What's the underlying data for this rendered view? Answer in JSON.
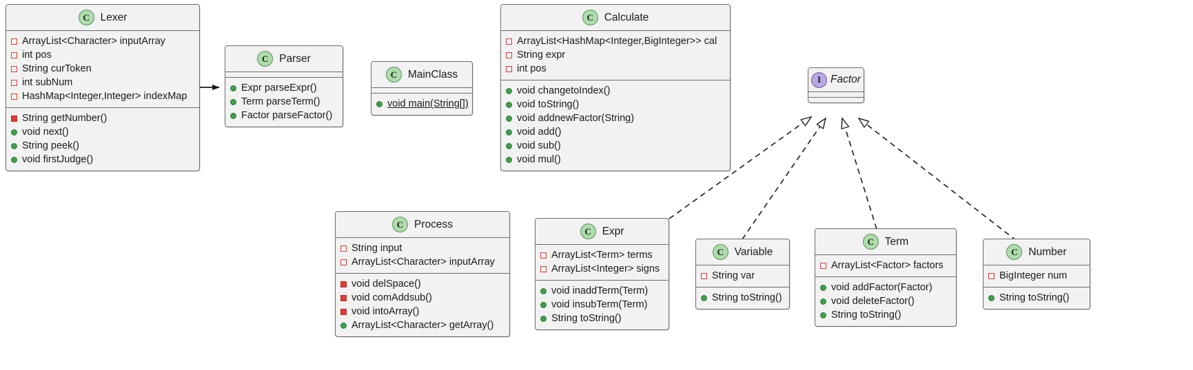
{
  "diagram": {
    "kind": "uml-class-diagram",
    "background": "#ffffff",
    "colors": {
      "class_icon_fill": "#adddab",
      "interface_icon_fill": "#b9a8e0",
      "private_field_marker": "#d33d3d",
      "public_method_marker": "#3f9e4d",
      "private_method_marker": "#e23b35",
      "node_fill": "#f2f2f2",
      "node_border": "#6b6b6b"
    }
  },
  "nodes": [
    {
      "id": "lexer",
      "name": "Lexer",
      "stereotype": "C",
      "fields": [
        {
          "visibility": "private",
          "text": "ArrayList<Character> inputArray"
        },
        {
          "visibility": "private",
          "text": "int pos"
        },
        {
          "visibility": "private",
          "text": "String curToken"
        },
        {
          "visibility": "private",
          "text": "int subNum"
        },
        {
          "visibility": "private",
          "text": "HashMap<Integer,Integer> indexMap"
        }
      ],
      "methods": [
        {
          "visibility": "private",
          "text": "String getNumber()"
        },
        {
          "visibility": "public",
          "text": "void next()"
        },
        {
          "visibility": "public",
          "text": "String peek()"
        },
        {
          "visibility": "public",
          "text": "void firstJudge()"
        }
      ]
    },
    {
      "id": "parser",
      "name": "Parser",
      "stereotype": "C",
      "fields": [],
      "methods": [
        {
          "visibility": "public",
          "text": "Expr parseExpr()"
        },
        {
          "visibility": "public",
          "text": "Term parseTerm()"
        },
        {
          "visibility": "public",
          "text": "Factor parseFactor()"
        }
      ]
    },
    {
      "id": "mainclass",
      "name": "MainClass",
      "stereotype": "C",
      "fields": [],
      "methods": [
        {
          "visibility": "public",
          "text": "void main(String[])",
          "static": true
        }
      ]
    },
    {
      "id": "calculate",
      "name": "Calculate",
      "stereotype": "C",
      "fields": [
        {
          "visibility": "private",
          "text": "ArrayList<HashMap<Integer,BigInteger>> cal"
        },
        {
          "visibility": "private",
          "text": "String expr"
        },
        {
          "visibility": "private",
          "text": "int pos"
        }
      ],
      "methods": [
        {
          "visibility": "public",
          "text": "void changetoIndex()"
        },
        {
          "visibility": "public",
          "text": "void toString()"
        },
        {
          "visibility": "public",
          "text": "void addnewFactor(String)"
        },
        {
          "visibility": "public",
          "text": "void add()"
        },
        {
          "visibility": "public",
          "text": "void sub()"
        },
        {
          "visibility": "public",
          "text": "void mul()"
        }
      ]
    },
    {
      "id": "factor",
      "name": "Factor",
      "stereotype": "I",
      "fields": [],
      "methods": []
    },
    {
      "id": "process",
      "name": "Process",
      "stereotype": "C",
      "fields": [
        {
          "visibility": "private",
          "text": "String input"
        },
        {
          "visibility": "private",
          "text": "ArrayList<Character> inputArray"
        }
      ],
      "methods": [
        {
          "visibility": "private",
          "text": "void delSpace()"
        },
        {
          "visibility": "private",
          "text": "void comAddsub()"
        },
        {
          "visibility": "private",
          "text": "void intoArray()"
        },
        {
          "visibility": "public",
          "text": "ArrayList<Character> getArray()"
        }
      ]
    },
    {
      "id": "expr",
      "name": "Expr",
      "stereotype": "C",
      "fields": [
        {
          "visibility": "private",
          "text": "ArrayList<Term> terms"
        },
        {
          "visibility": "private",
          "text": "ArrayList<Integer> signs"
        }
      ],
      "methods": [
        {
          "visibility": "public",
          "text": "void inaddTerm(Term)"
        },
        {
          "visibility": "public",
          "text": "void insubTerm(Term)"
        },
        {
          "visibility": "public",
          "text": "String toString()"
        }
      ]
    },
    {
      "id": "variable",
      "name": "Variable",
      "stereotype": "C",
      "fields": [
        {
          "visibility": "private",
          "text": "String var"
        }
      ],
      "methods": [
        {
          "visibility": "public",
          "text": "String toString()"
        }
      ]
    },
    {
      "id": "term",
      "name": "Term",
      "stereotype": "C",
      "fields": [
        {
          "visibility": "private",
          "text": "ArrayList<Factor> factors"
        }
      ],
      "methods": [
        {
          "visibility": "public",
          "text": "void addFactor(Factor)"
        },
        {
          "visibility": "public",
          "text": "void deleteFactor()"
        },
        {
          "visibility": "public",
          "text": "String toString()"
        }
      ]
    },
    {
      "id": "number",
      "name": "Number",
      "stereotype": "C",
      "fields": [
        {
          "visibility": "private",
          "text": "BigInteger num"
        }
      ],
      "methods": [
        {
          "visibility": "public",
          "text": "String toString()"
        }
      ]
    }
  ],
  "edges": [
    {
      "from": "lexer",
      "to": "parser",
      "type": "association"
    },
    {
      "from": "expr",
      "to": "factor",
      "type": "realization"
    },
    {
      "from": "variable",
      "to": "factor",
      "type": "realization"
    },
    {
      "from": "term",
      "to": "factor",
      "type": "realization"
    },
    {
      "from": "number",
      "to": "factor",
      "type": "realization"
    }
  ]
}
